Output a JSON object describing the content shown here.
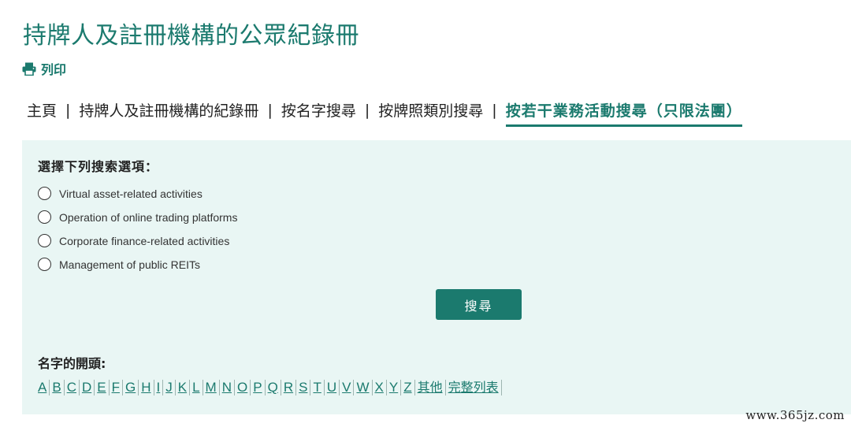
{
  "page": {
    "title": "持牌人及註冊機構的公眾紀錄冊",
    "print_label": "列印"
  },
  "breadcrumb": {
    "items": [
      "主頁",
      "持牌人及註冊機構的紀錄冊",
      "按名字搜尋",
      "按牌照類別搜尋",
      "按若干業務活動搜尋（只限法團）"
    ],
    "separator": "|"
  },
  "search": {
    "heading": "選擇下列搜索選項：",
    "options": [
      "Virtual asset-related activities",
      "Operation of online trading platforms",
      "Corporate finance-related activities",
      "Management of public REITs"
    ],
    "button_label": "搜尋"
  },
  "alphabet": {
    "heading": "名字的開頭:",
    "letters": [
      "A",
      "B",
      "C",
      "D",
      "E",
      "F",
      "G",
      "H",
      "I",
      "J",
      "K",
      "L",
      "M",
      "N",
      "O",
      "P",
      "Q",
      "R",
      "S",
      "T",
      "U",
      "V",
      "W",
      "X",
      "Y",
      "Z"
    ],
    "other_label": "其他",
    "full_list_label": "完整列表"
  },
  "watermark": "www.365jz.com",
  "colors": {
    "accent": "#1b7a6e",
    "panel_bg": "#e9f6f4"
  },
  "icons": {
    "print": "printer-icon",
    "option": "radio-circle"
  }
}
